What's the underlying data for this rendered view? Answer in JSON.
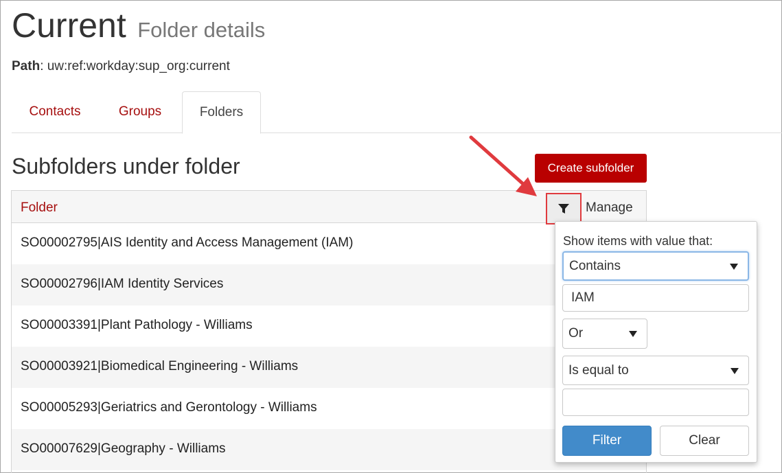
{
  "header": {
    "title": "Current",
    "subtitle": "Folder details"
  },
  "path": {
    "label": "Path",
    "value": ": uw:ref:workday:sup_org:current"
  },
  "tabs": [
    {
      "label": "Contacts",
      "active": false
    },
    {
      "label": "Groups",
      "active": false
    },
    {
      "label": "Folders",
      "active": true
    }
  ],
  "section": {
    "title": "Subfolders under folder",
    "create_button": "Create subfolder"
  },
  "grid": {
    "columns": {
      "folder": "Folder",
      "manage": "Manage"
    },
    "rows": [
      "SO00002795|AIS Identity and Access Management (IAM)",
      "SO00002796|IAM Identity Services",
      "SO00003391|Plant Pathology - Williams",
      "SO00003921|Biomedical Engineering - Williams",
      "SO00005293|Geriatrics and Gerontology - Williams",
      "SO00007629|Geography - Williams"
    ]
  },
  "filter_popup": {
    "label": "Show items with value that:",
    "operator1": "Contains",
    "value1": "IAM",
    "logic": "Or",
    "operator2": "Is equal to",
    "value2": "",
    "filter_button": "Filter",
    "clear_button": "Clear"
  },
  "colors": {
    "brand_red": "#b90000",
    "link_red": "#a60f0f",
    "primary_blue": "#428bca",
    "annotation_red": "#e03a3e"
  }
}
